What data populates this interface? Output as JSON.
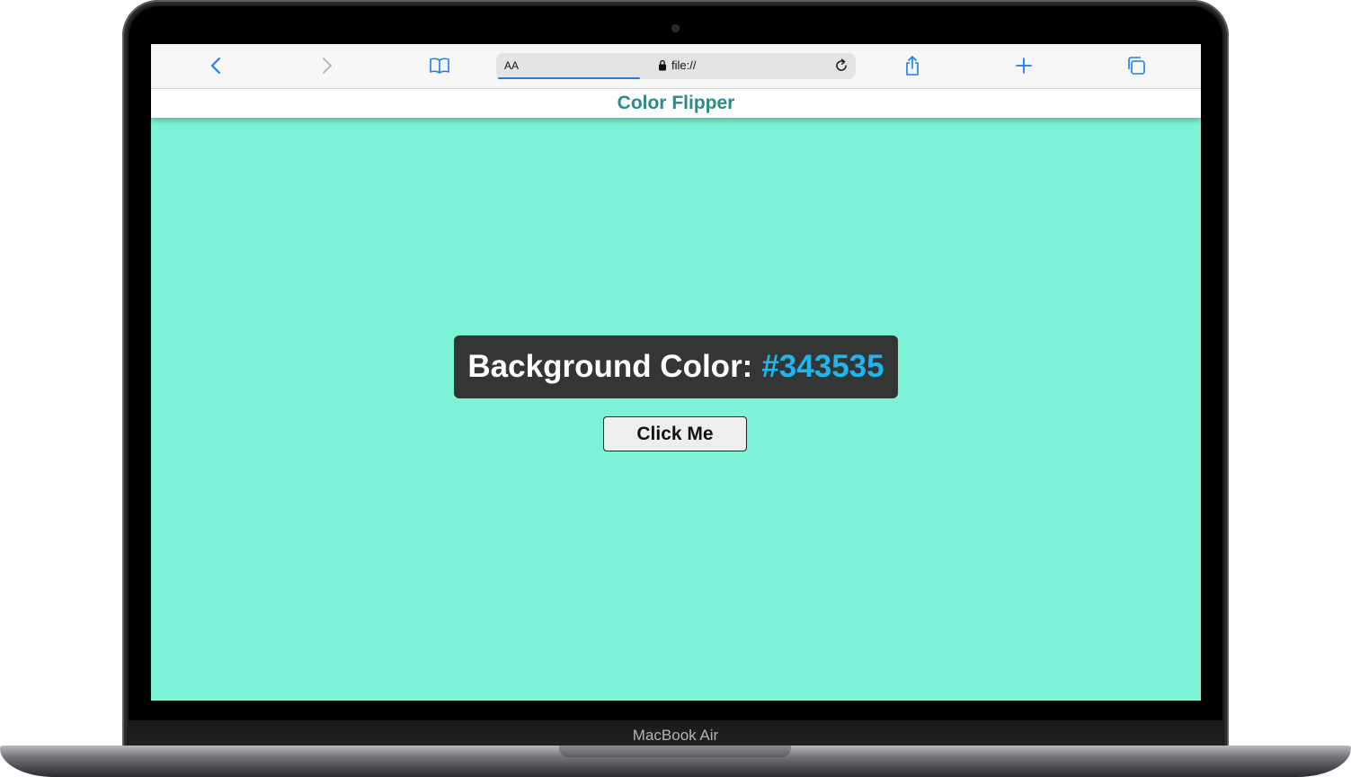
{
  "device": {
    "label": "MacBook Air"
  },
  "browser": {
    "address_bar": {
      "text_size_label": "AA",
      "url": "file://"
    },
    "icons": {
      "back": "chevron-left-icon",
      "forward": "chevron-right-icon",
      "bookmarks": "book-icon",
      "lock": "lock-icon",
      "reload": "reload-icon",
      "share": "share-icon",
      "new_tab": "plus-icon",
      "tabs": "tabs-icon"
    },
    "accent_color": "#1a7cf2"
  },
  "page": {
    "header_title": "Color Flipper",
    "header_color": "#2a8a88",
    "background_color": "#7cf3d6",
    "color_label": "Background Color:",
    "color_value": "#343535",
    "color_value_color": "#1fb6f0",
    "button_label": "Click Me"
  }
}
